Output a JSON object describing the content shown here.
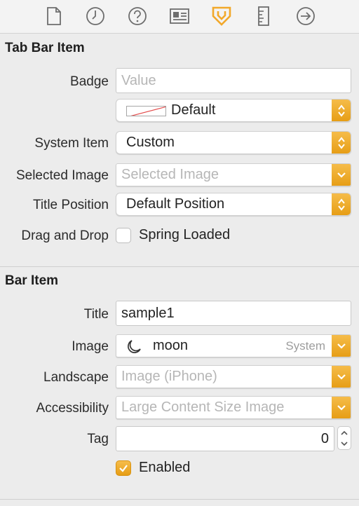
{
  "toolbar": {
    "icons": [
      "file-inspector-icon",
      "history-icon",
      "quick-help-icon",
      "identity-icon",
      "attributes-icon",
      "size-icon",
      "connections-icon"
    ]
  },
  "tab_bar_item": {
    "section_title": "Tab Bar Item",
    "badge_label": "Badge",
    "badge_placeholder": "Value",
    "badge_color_value": "Default",
    "system_item_label": "System Item",
    "system_item_value": "Custom",
    "selected_image_label": "Selected Image",
    "selected_image_placeholder": "Selected Image",
    "title_position_label": "Title Position",
    "title_position_value": "Default Position",
    "drag_drop_label": "Drag and Drop",
    "spring_loaded_label": "Spring Loaded",
    "spring_loaded_checked": false
  },
  "bar_item": {
    "section_title": "Bar Item",
    "title_label": "Title",
    "title_value": "sample1",
    "image_label": "Image",
    "image_value": "moon",
    "image_source": "System",
    "landscape_label": "Landscape",
    "landscape_placeholder": "Image (iPhone)",
    "accessibility_label": "Accessibility",
    "accessibility_placeholder": "Large Content Size Image",
    "tag_label": "Tag",
    "tag_value": "0",
    "enabled_label": "Enabled",
    "enabled_checked": true
  },
  "colors": {
    "accent": "#f0aa2c",
    "selected_tab_icon": "#f2a82a"
  }
}
